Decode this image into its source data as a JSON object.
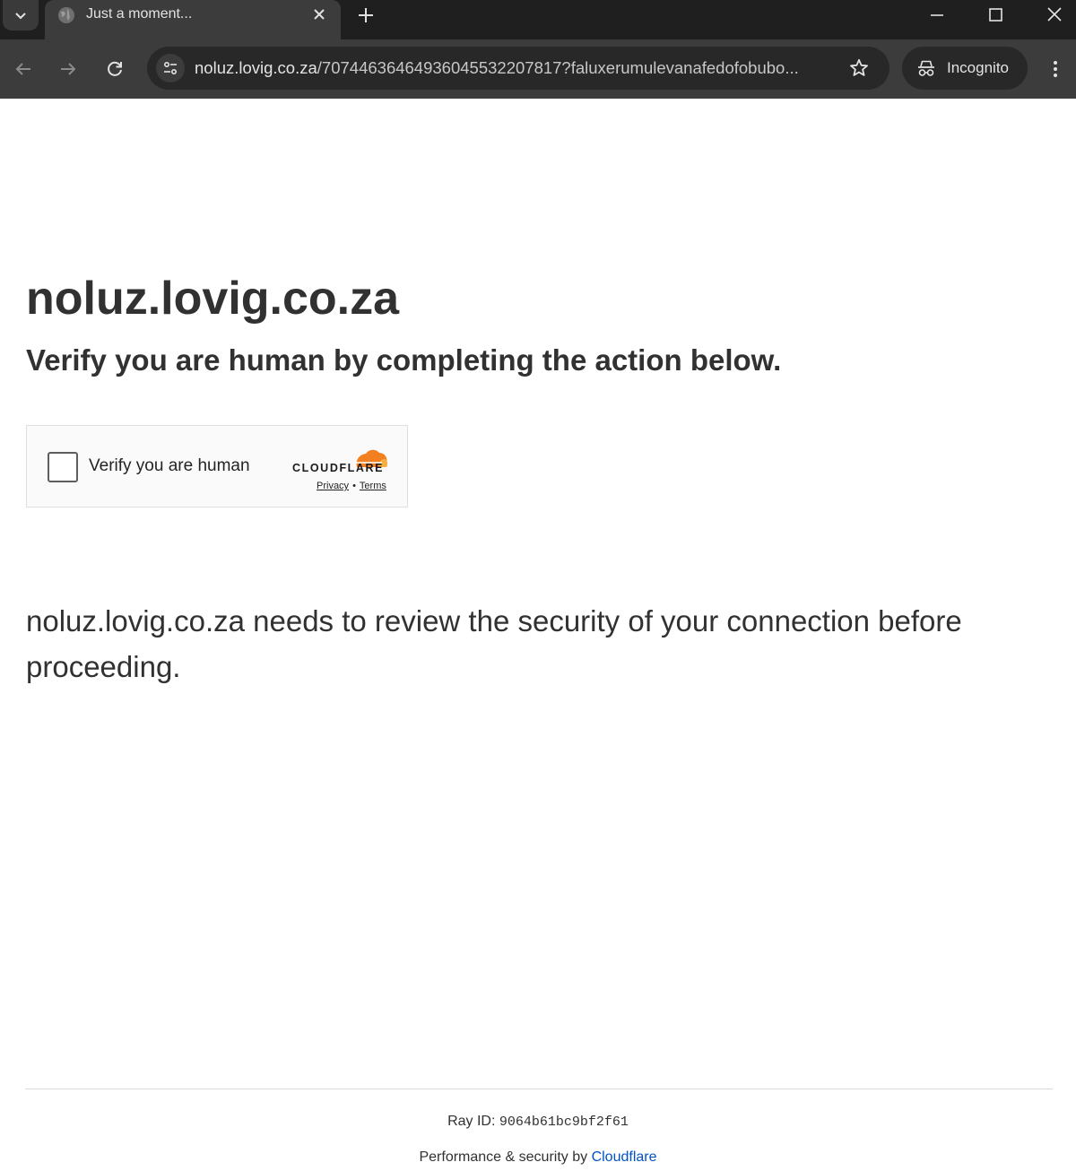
{
  "browser": {
    "tab_title": "Just a moment...",
    "url_host": "noluz.lovig.co.za",
    "url_path": "/70744636464936045532207817?faluxerumulevanafedofobubo...",
    "incognito_label": "Incognito"
  },
  "page": {
    "domain_heading": "noluz.lovig.co.za",
    "subheading": "Verify you are human by completing the action below.",
    "widget": {
      "checkbox_label": "Verify you are human",
      "brand": "CLOUDFLARE",
      "privacy_link": "Privacy",
      "separator": "•",
      "terms_link": "Terms",
      "brand_color": "#f38020"
    },
    "review_message": "noluz.lovig.co.za needs to review the security of your connection before proceeding.",
    "footer": {
      "ray_label": "Ray ID:",
      "ray_value": "9064b61bc9bf2f61",
      "perf_text": "Performance & security by",
      "perf_link": "Cloudflare",
      "link_color": "#0051c3"
    }
  },
  "icons": [
    "chevron-down-icon",
    "globe-icon",
    "close-icon",
    "plus-icon",
    "minimize-icon",
    "maximize-icon",
    "window-close-icon",
    "back-icon",
    "forward-icon",
    "reload-icon",
    "site-settings-icon",
    "star-icon",
    "incognito-icon",
    "more-vert-icon",
    "cloudflare-cloud-icon"
  ]
}
